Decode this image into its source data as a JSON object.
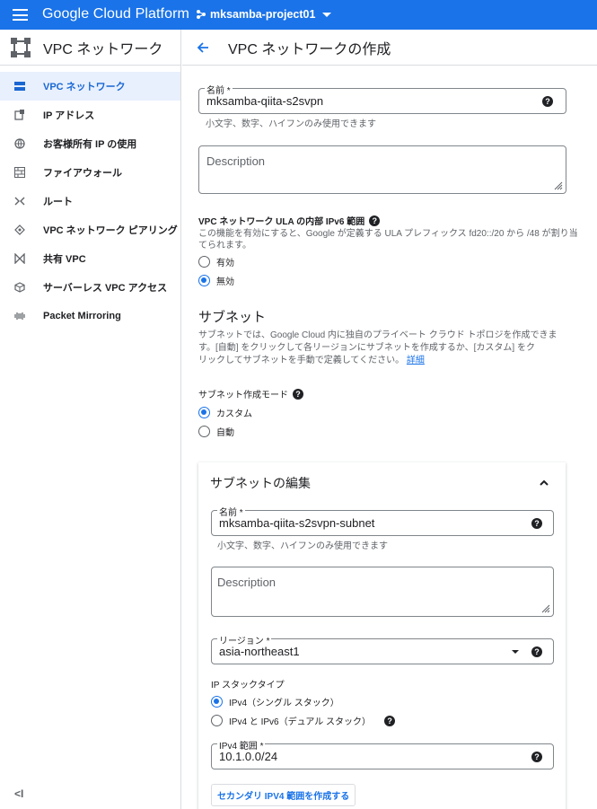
{
  "topbar": {
    "brand": "Google Cloud Platform",
    "project": "mksamba-project01"
  },
  "sidebar": {
    "title": "VPC ネットワーク",
    "items": [
      {
        "label": "VPC ネットワーク",
        "icon": "vpc-network-icon",
        "active": true
      },
      {
        "label": "IP アドレス",
        "icon": "ip-address-icon"
      },
      {
        "label": "お客様所有 IP の使用",
        "icon": "globe-icon"
      },
      {
        "label": "ファイアウォール",
        "icon": "firewall-icon"
      },
      {
        "label": "ルート",
        "icon": "route-icon"
      },
      {
        "label": "VPC ネットワーク ピアリング",
        "icon": "peering-icon"
      },
      {
        "label": "共有 VPC",
        "icon": "shared-vpc-icon"
      },
      {
        "label": "サーバーレス VPC アクセス",
        "icon": "serverless-icon"
      },
      {
        "label": "Packet Mirroring",
        "icon": "packet-mirroring-icon"
      }
    ],
    "collapse": "<I"
  },
  "main": {
    "title": "VPC ネットワークの作成",
    "name_label": "名前 *",
    "name_value": "mksamba-qiita-s2svpn",
    "name_hint": "小文字、数字、ハイフンのみ使用できます",
    "description_placeholder": "Description",
    "ula_label": "VPC ネットワーク ULA の内部 IPv6 範囲",
    "ula_desc_line1": "この機能を有効にすると、Google が定義する ULA プレフィックス fd20::/20 から /48 が割り当",
    "ula_desc_line2": "てられます。",
    "ula_on": "有効",
    "ula_off": "無効",
    "subnet_title": "サブネット",
    "subnet_desc_line1": "サブネットでは、Google Cloud 内に独自のプライベート クラウド トポロジを作成できま",
    "subnet_desc_line2": "す。[自動] をクリックして各リージョンにサブネットを作成するか、[カスタム] をク",
    "subnet_desc_line3": "リックしてサブネットを手動で定義してください。",
    "subnet_detail_link": "詳細",
    "subnet_mode_label": "サブネット作成モード",
    "mode_custom": "カスタム",
    "mode_auto": "自動"
  },
  "subnet_edit": {
    "title": "サブネットの編集",
    "name_label": "名前 *",
    "name_value": "mksamba-qiita-s2svpn-subnet",
    "name_hint": "小文字、数字、ハイフンのみ使用できます",
    "description_placeholder": "Description",
    "region_label": "リージョン *",
    "region_value": "asia-northeast1",
    "stack_label": "IP スタックタイプ",
    "stack_ipv4": "IPv4（シングル スタック）",
    "stack_dual": "IPv4 と IPv6（デュアル スタック）",
    "ipv4_label": "IPv4 範囲 *",
    "ipv4_value": "10.1.0.0/24",
    "secondary_button": "セカンダリ IPV4 範囲を作成する"
  },
  "colors": {
    "brand_blue": "#1a73e8",
    "active_bg": "#e8f0fe"
  }
}
